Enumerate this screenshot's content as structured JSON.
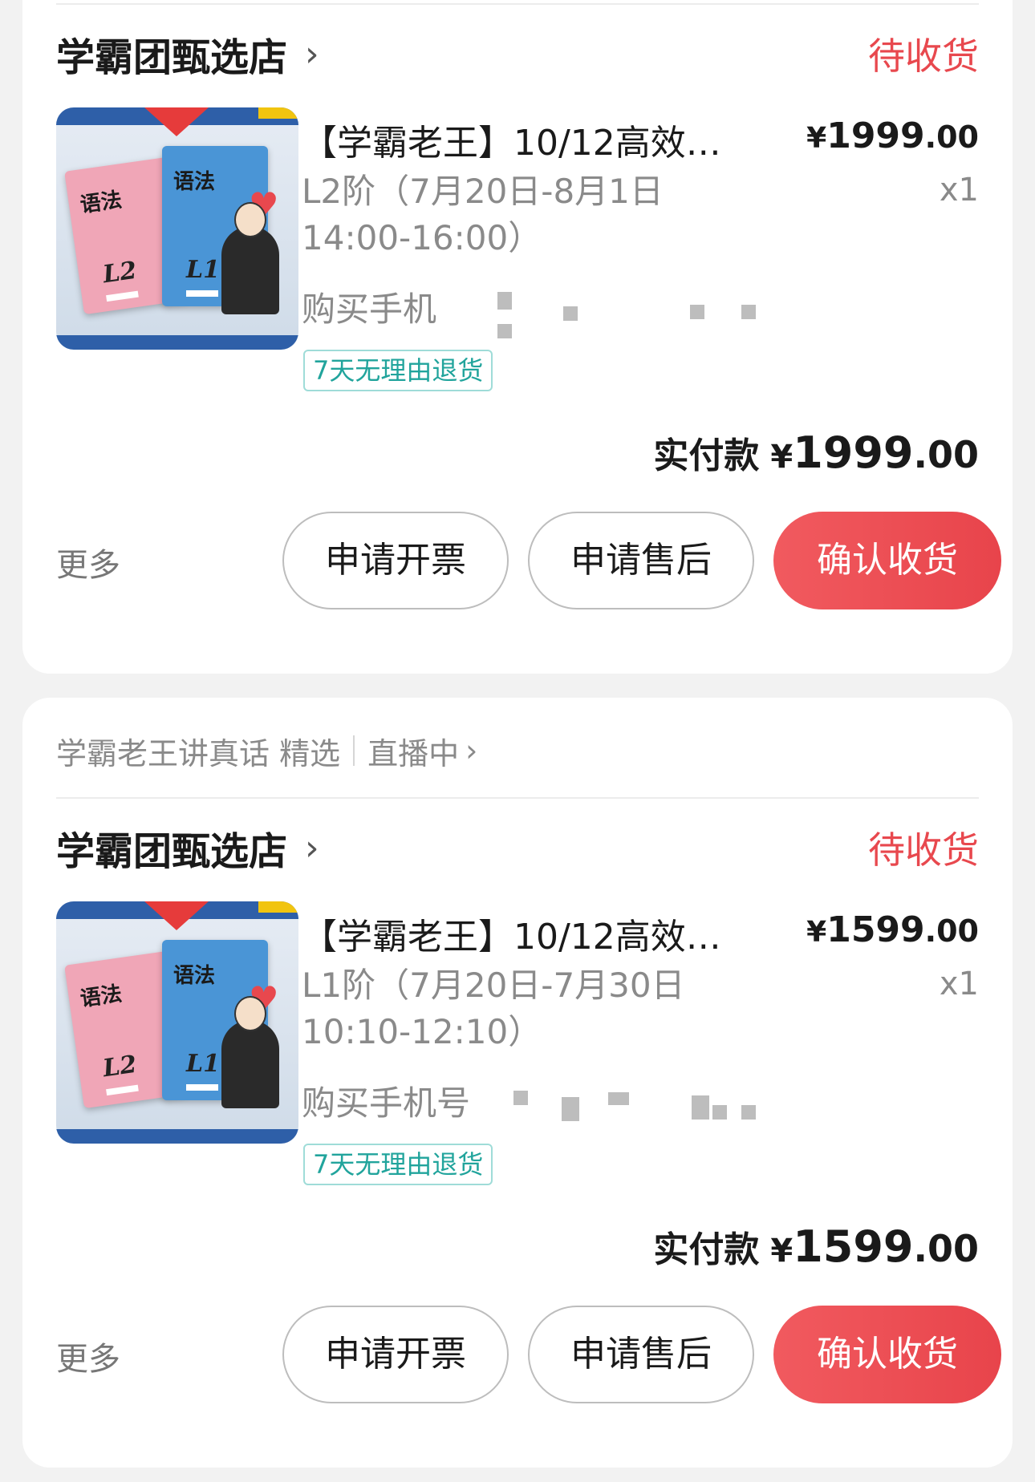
{
  "orders": [
    {
      "shop_name": "学霸团甄选店",
      "status": "待收货",
      "product_title": "【学霸老王】10/12高效…",
      "price_yen": "¥",
      "price_int": "1999",
      "price_dec": ".00",
      "spec": "L2阶（7月20日-8月1日14:00-16:00）",
      "quantity": "x1",
      "phone_label": "购买手机",
      "tag": "7天无理由退货",
      "paid_label": "实付款",
      "paid_yen": "¥",
      "paid_int": "1999",
      "paid_dec": ".00",
      "more": "更多",
      "btn_invoice": "申请开票",
      "btn_after_sale": "申请售后",
      "btn_confirm": "确认收货",
      "image": {
        "book_title_left": "语法",
        "book_title_right": "语法",
        "book_level_left": "L2",
        "book_level_right": "L1"
      }
    },
    {
      "live_header": {
        "channel": "学霸老王讲真话 精选",
        "live_status": "直播中"
      },
      "shop_name": "学霸团甄选店",
      "status": "待收货",
      "product_title": "【学霸老王】10/12高效…",
      "price_yen": "¥",
      "price_int": "1599",
      "price_dec": ".00",
      "spec": "L1阶（7月20日-7月30日10:10-12:10）",
      "quantity": "x1",
      "phone_label": "购买手机号",
      "tag": "7天无理由退货",
      "paid_label": "实付款",
      "paid_yen": "¥",
      "paid_int": "1599",
      "paid_dec": ".00",
      "more": "更多",
      "btn_invoice": "申请开票",
      "btn_after_sale": "申请售后",
      "btn_confirm": "确认收货",
      "image": {
        "book_title_left": "语法",
        "book_title_right": "语法",
        "book_level_left": "L2",
        "book_level_right": "L1"
      }
    }
  ],
  "colors": {
    "accent_red": "#e8484e",
    "tag_teal": "#21a49c",
    "muted_gray": "#8a8a8a"
  },
  "icons": [
    "chevron-right-icon",
    "heart-icon"
  ]
}
